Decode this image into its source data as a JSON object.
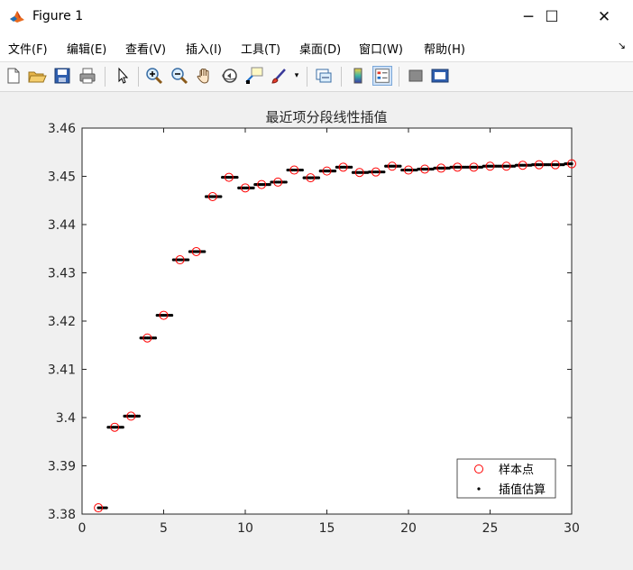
{
  "window": {
    "title": "Figure 1",
    "minimize_glyph": "─",
    "maximize_glyph": "☐",
    "close_glyph": "✕",
    "icon": "matlab-logo-icon"
  },
  "menubar": {
    "items": [
      "文件(F)",
      "编辑(E)",
      "查看(V)",
      "插入(I)",
      "工具(T)",
      "桌面(D)",
      "窗口(W)",
      "帮助(H)"
    ],
    "overflow_glyph": "↘"
  },
  "toolbar": {
    "icons": [
      "new-figure-icon",
      "open-file-icon",
      "save-icon",
      "print-icon",
      "pointer-icon",
      "zoom-in-icon",
      "zoom-out-icon",
      "pan-icon",
      "rotate-3d-icon",
      "data-cursor-icon",
      "brush-icon",
      "link-plot-icon",
      "colorbar-icon",
      "legend-icon",
      "hide-plot-tools-icon",
      "show-plot-tools-icon"
    ]
  },
  "chart_data": {
    "type": "scatter",
    "title": "最近项分段线性插值",
    "xlabel": "",
    "ylabel": "",
    "xlim": [
      0,
      30
    ],
    "ylim": [
      3.38,
      3.46
    ],
    "xticks": [
      "0",
      "5",
      "10",
      "15",
      "20",
      "25",
      "30"
    ],
    "yticks": [
      "3.38",
      "3.39",
      "3.4",
      "3.41",
      "3.42",
      "3.43",
      "3.44",
      "3.45",
      "3.46"
    ],
    "grid": false,
    "legend_position": "bottom-right",
    "series": [
      {
        "name": "样本点",
        "marker": "circle",
        "color": "#ff0000",
        "x": [
          1,
          2,
          3,
          4,
          5,
          6,
          7,
          8,
          9,
          10,
          11,
          12,
          13,
          14,
          15,
          16,
          17,
          18,
          19,
          20,
          21,
          22,
          23,
          24,
          25,
          26,
          27,
          28,
          29,
          30
        ],
        "y": [
          3.3813,
          3.398,
          3.4003,
          3.4165,
          3.4212,
          3.4327,
          3.4344,
          3.4458,
          3.4498,
          3.4476,
          3.4483,
          3.4488,
          3.4513,
          3.4497,
          3.4511,
          3.4519,
          3.4508,
          3.4509,
          3.4521,
          3.4513,
          3.4515,
          3.4517,
          3.4519,
          3.4519,
          3.4521,
          3.4521,
          3.4523,
          3.4524,
          3.4524,
          3.4526
        ]
      },
      {
        "name": "插值估算",
        "marker": "point",
        "color": "#000000",
        "x_step": 0.1,
        "method": "nearest"
      }
    ]
  }
}
